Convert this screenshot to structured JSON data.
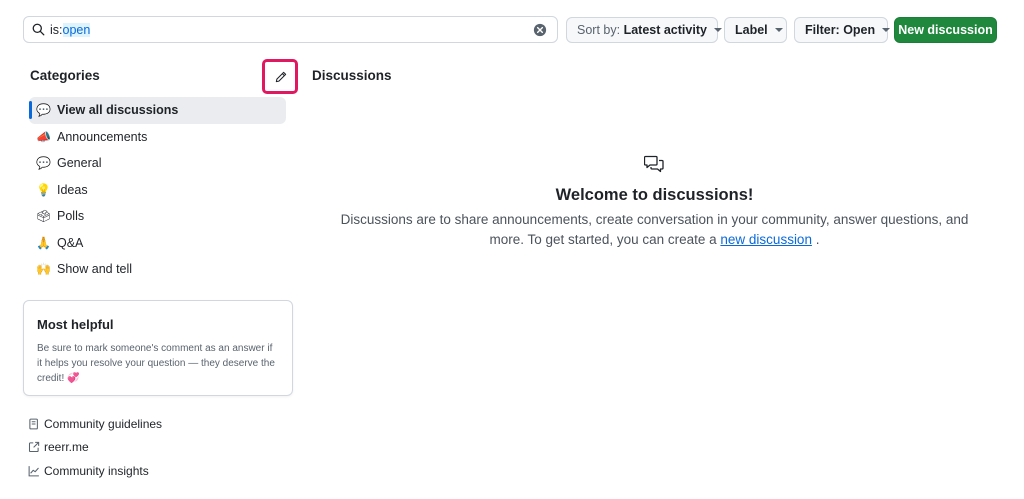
{
  "search": {
    "qualifier_key": "is:",
    "qualifier_value": "open"
  },
  "toolbar": {
    "sort_prefix": "Sort by:",
    "sort_value": "Latest activity",
    "label_button": "Label",
    "filter_label": "Filter: Open",
    "new_discussion": "New discussion"
  },
  "sidebar": {
    "title": "Categories",
    "items": [
      {
        "emoji": "💬",
        "label": "View all discussions",
        "active": true
      },
      {
        "emoji": "📣",
        "label": "Announcements"
      },
      {
        "emoji": "💬",
        "label": "General"
      },
      {
        "emoji": "💡",
        "label": "Ideas"
      },
      {
        "emoji": "🗳",
        "label": "Polls"
      },
      {
        "emoji": "🙏",
        "label": "Q&A"
      },
      {
        "emoji": "🙌",
        "label": "Show and tell"
      }
    ],
    "most_helpful": {
      "title": "Most helpful",
      "body": "Be sure to mark someone's comment as an answer if it helps you resolve your question — they deserve the credit! 💞"
    },
    "footer_links": [
      {
        "icon": "guidelines-icon",
        "label": "Community guidelines"
      },
      {
        "icon": "external-link-icon",
        "label": "reerr.me"
      },
      {
        "icon": "graph-icon",
        "label": "Community insights"
      }
    ]
  },
  "main": {
    "title": "Discussions",
    "empty_state": {
      "icon": "comment-discussion-icon",
      "heading": "Welcome to discussions!",
      "body_before": "Discussions are to share announcements, create conversation in your community, answer questions, and more. To get started, you can create a ",
      "link_text": "new discussion",
      "body_after": " ."
    }
  },
  "colors": {
    "accent": "#0969da",
    "primary_button": "#1f883d",
    "highlight_border": "#e0185f"
  }
}
